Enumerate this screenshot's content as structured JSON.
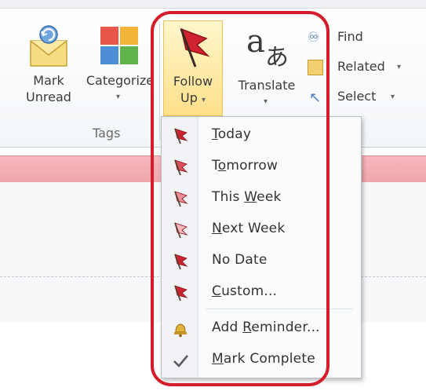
{
  "ribbon": {
    "mark_unread": {
      "line1": "Mark",
      "line2": "Unread"
    },
    "categorize": {
      "label": "Categorize"
    },
    "follow_up": {
      "line1": "Follow",
      "line2": "Up"
    },
    "translate": {
      "label": "Translate"
    },
    "find": {
      "label": "Find"
    },
    "related": {
      "label": "Related"
    },
    "select": {
      "label": "Select"
    },
    "tags_group_label": "Tags"
  },
  "menu": {
    "items": [
      {
        "pre": "",
        "accel": "T",
        "post": "oday",
        "flag_color": "#c8262e"
      },
      {
        "pre": "T",
        "accel": "o",
        "post": "morrow",
        "flag_color": "#d9505a"
      },
      {
        "pre": "This ",
        "accel": "W",
        "post": "eek",
        "flag_color": "#ef8e96"
      },
      {
        "pre": "",
        "accel": "N",
        "post": "ext Week",
        "flag_color": "#f4b6bb"
      },
      {
        "pre": "No Date",
        "accel": "",
        "post": "",
        "flag_color": "#c8262e"
      },
      {
        "pre": "",
        "accel": "C",
        "post": "ustom...",
        "flag_color": "#c8262e"
      },
      {
        "pre": "Add ",
        "accel": "R",
        "post": "eminder...",
        "icon": "bell-icon"
      },
      {
        "pre": "",
        "accel": "M",
        "post": "ark Complete",
        "icon": "checkmark-icon"
      }
    ]
  },
  "colors": {
    "highlight_ring": "#d41c2a",
    "pink_bar": "#f3adb4"
  }
}
